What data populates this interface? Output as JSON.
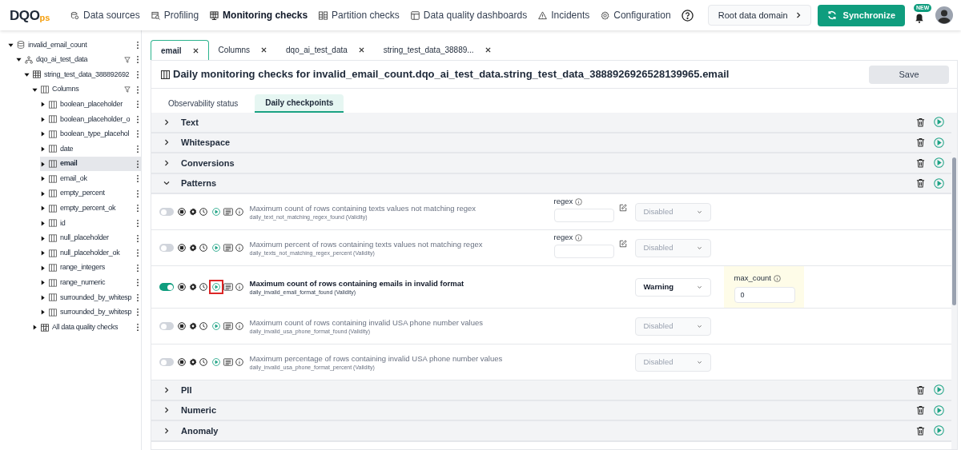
{
  "logo": {
    "main": "DQO",
    "suffix": "ps"
  },
  "nav": [
    {
      "label": "Data sources",
      "selected": false
    },
    {
      "label": "Profiling",
      "selected": false
    },
    {
      "label": "Monitoring checks",
      "selected": true
    },
    {
      "label": "Partition checks",
      "selected": false
    },
    {
      "label": "Data quality dashboards",
      "selected": false
    },
    {
      "label": "Incidents",
      "selected": false
    },
    {
      "label": "Configuration",
      "selected": false
    }
  ],
  "domain_button": "Root data domain",
  "sync_button": "Synchronize",
  "notification_badge": "NEW",
  "tree": [
    {
      "label": "invalid_email_count",
      "kind": "connection",
      "expanded": true,
      "selected": false,
      "children": [
        {
          "label": "dqo_ai_test_data",
          "kind": "schema",
          "expanded": true,
          "selected": false,
          "filter": true,
          "children": [
            {
              "label": "string_test_data_388892692",
              "kind": "table",
              "expanded": true,
              "selected": false,
              "children": [
                {
                  "label": "Columns",
                  "kind": "columns",
                  "expanded": true,
                  "selected": false,
                  "filter": true,
                  "children": [
                    {
                      "label": "boolean_placeholder",
                      "kind": "column",
                      "expanded": false,
                      "selected": false
                    },
                    {
                      "label": "boolean_placeholder_o",
                      "kind": "column",
                      "expanded": false,
                      "selected": false
                    },
                    {
                      "label": "boolean_type_placehol",
                      "kind": "column",
                      "expanded": false,
                      "selected": false
                    },
                    {
                      "label": "date",
                      "kind": "column",
                      "expanded": false,
                      "selected": false
                    },
                    {
                      "label": "email",
                      "kind": "column",
                      "expanded": false,
                      "selected": true
                    },
                    {
                      "label": "email_ok",
                      "kind": "column",
                      "expanded": false,
                      "selected": false
                    },
                    {
                      "label": "empty_percent",
                      "kind": "column",
                      "expanded": false,
                      "selected": false
                    },
                    {
                      "label": "empty_percent_ok",
                      "kind": "column",
                      "expanded": false,
                      "selected": false
                    },
                    {
                      "label": "id",
                      "kind": "column",
                      "expanded": false,
                      "selected": false
                    },
                    {
                      "label": "null_placeholder",
                      "kind": "column",
                      "expanded": false,
                      "selected": false
                    },
                    {
                      "label": "null_placeholder_ok",
                      "kind": "column",
                      "expanded": false,
                      "selected": false
                    },
                    {
                      "label": "range_integers",
                      "kind": "column",
                      "expanded": false,
                      "selected": false
                    },
                    {
                      "label": "range_numeric",
                      "kind": "column",
                      "expanded": false,
                      "selected": false
                    },
                    {
                      "label": "surrounded_by_whitesp",
                      "kind": "column",
                      "expanded": false,
                      "selected": false
                    },
                    {
                      "label": "surrounded_by_whitesp",
                      "kind": "column",
                      "expanded": false,
                      "selected": false
                    }
                  ]
                },
                {
                  "label": "All data quality checks",
                  "kind": "checks",
                  "expanded": false,
                  "selected": false
                }
              ]
            }
          ]
        }
      ]
    }
  ],
  "tabs": [
    {
      "label": "email",
      "selected": true
    },
    {
      "label": "Columns",
      "selected": false
    },
    {
      "label": "dqo_ai_test_data",
      "selected": false
    },
    {
      "label": "string_test_data_38889...",
      "selected": false
    }
  ],
  "page_title": "Daily monitoring checks for invalid_email_count.dqo_ai_test_data.string_test_data_3888926926528139965.email",
  "save_button": "Save",
  "subtabs": [
    {
      "label": "Observability status",
      "selected": false
    },
    {
      "label": "Daily checkpoints",
      "selected": true
    }
  ],
  "categories": [
    {
      "name": "Text",
      "expanded": false
    },
    {
      "name": "Whitespace",
      "expanded": false
    },
    {
      "name": "Conversions",
      "expanded": false
    },
    {
      "name": "Patterns",
      "expanded": true,
      "checks": [
        {
          "title": "Maximum count of rows containing texts values not matching regex",
          "subtitle": "daily_text_not_matching_regex_found (Validity)",
          "enabled": false,
          "highlighted": false,
          "sensor_param": {
            "label": "regex"
          },
          "severity": "Disabled"
        },
        {
          "title": "Maximum percent of rows containing texts values not matching regex",
          "subtitle": "daily_texts_not_matching_regex_percent (Validity)",
          "enabled": false,
          "highlighted": false,
          "sensor_param": {
            "label": "regex"
          },
          "severity": "Disabled"
        },
        {
          "title": "Maximum count of rows containing emails in invalid format",
          "subtitle": "daily_invalid_email_format_found (Validity)",
          "enabled": true,
          "highlighted": true,
          "severity": "Warning",
          "rule_param": {
            "label": "max_count",
            "value": "0"
          }
        },
        {
          "title": "Maximum count of rows containing invalid USA phone number values",
          "subtitle": "daily_invalid_usa_phone_format_found (Validity)",
          "enabled": false,
          "highlighted": false,
          "severity": "Disabled"
        },
        {
          "title": "Maximum percentage of rows containing invalid USA phone number values",
          "subtitle": "daily_invalid_usa_phone_format_percent (Validity)",
          "enabled": false,
          "highlighted": false,
          "severity": "Disabled"
        }
      ]
    },
    {
      "name": "PII",
      "expanded": false
    },
    {
      "name": "Numeric",
      "expanded": false
    },
    {
      "name": "Anomaly",
      "expanded": false
    }
  ]
}
